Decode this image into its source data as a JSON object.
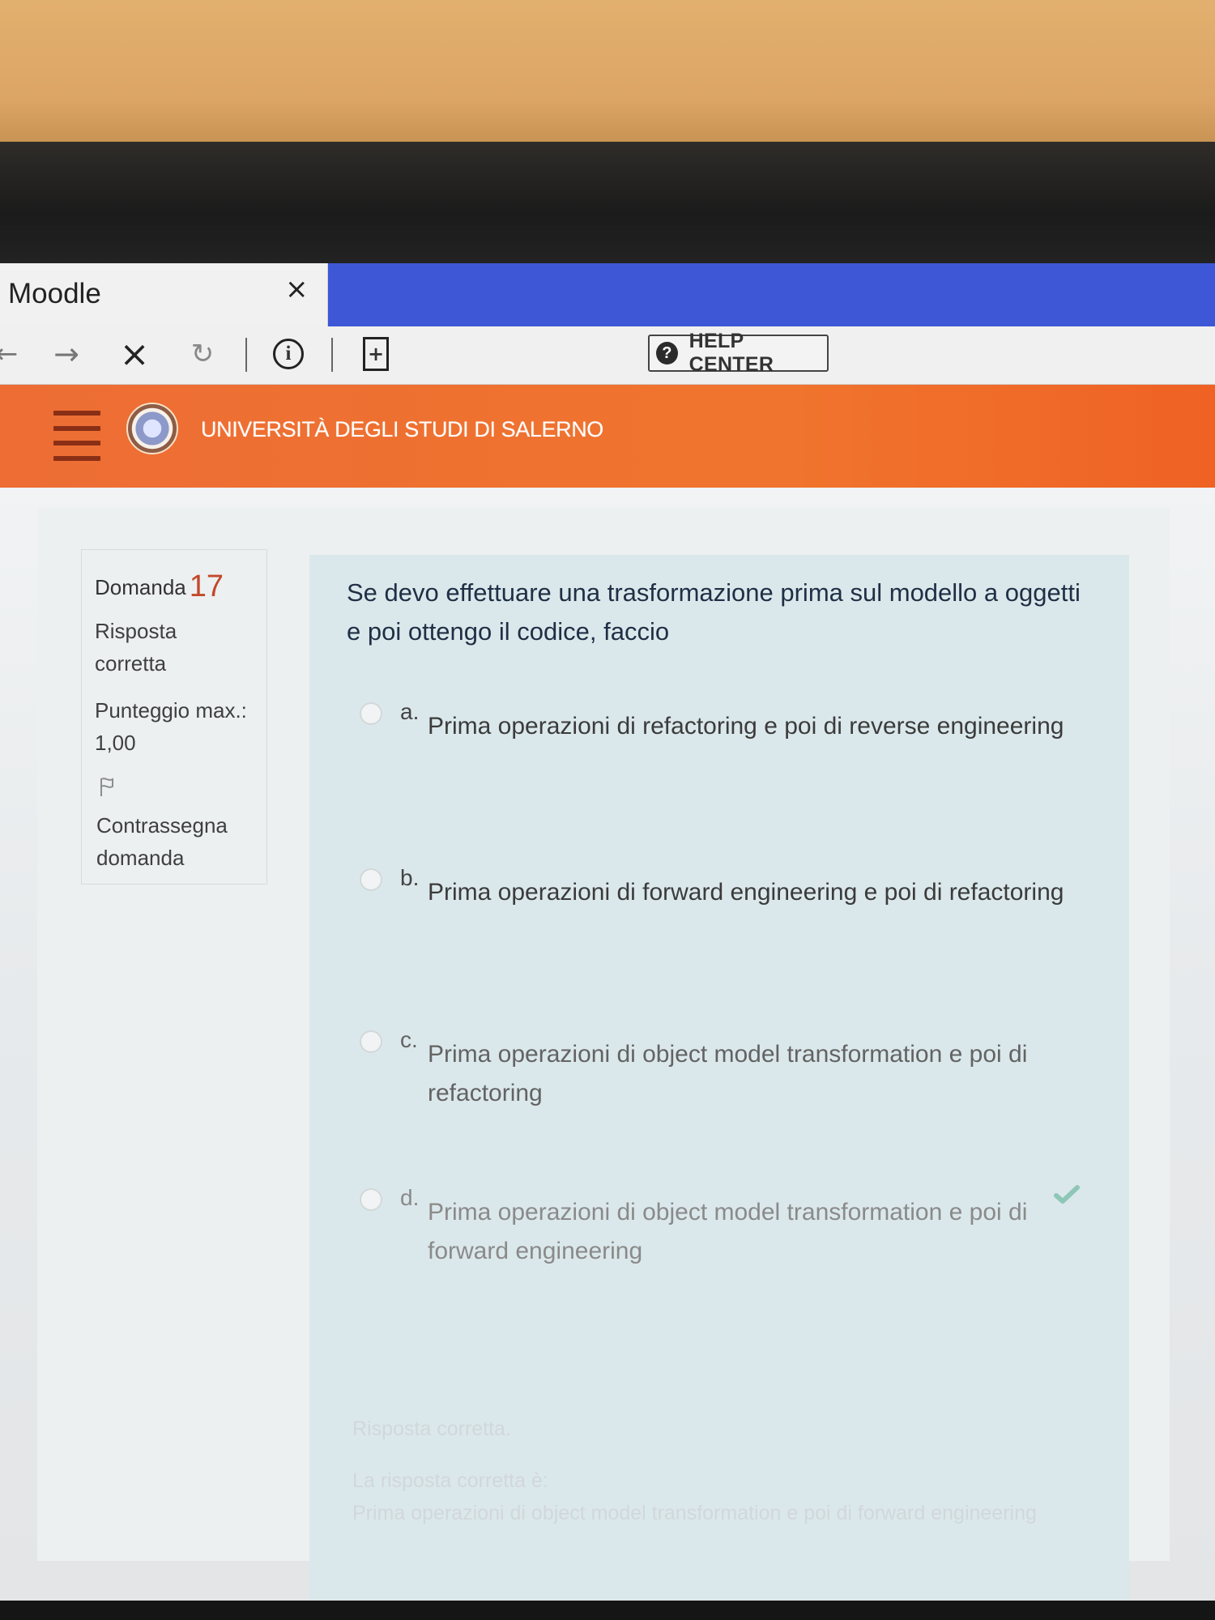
{
  "browser": {
    "tab_title": "Moodle",
    "help_center_label": "HELP CENTER"
  },
  "header": {
    "university_name": "UNIVERSITÀ DEGLI STUDI DI SALERNO"
  },
  "question_info": {
    "label": "Domanda",
    "number": "17",
    "status": "Risposta corretta",
    "score": "Punteggio max.: 1,00",
    "flag_text": "Contrassegna domanda"
  },
  "question": {
    "text": "Se devo effettuare una trasformazione prima sul modello a oggetti e poi ottengo il codice, faccio"
  },
  "answers": [
    {
      "letter": "a.",
      "text": "Prima operazioni di refactoring e poi di reverse engineering"
    },
    {
      "letter": "b.",
      "text": "Prima operazioni di forward engineering e poi di refactoring"
    },
    {
      "letter": "c.",
      "text": "Prima operazioni di object model transformation e poi di refactoring"
    },
    {
      "letter": "d.",
      "text": "Prima operazioni di object model transformation e poi di forward engineering"
    }
  ],
  "feedback": {
    "title": "Risposta corretta.",
    "line1": "La risposta corretta è:",
    "line2": "Prima operazioni di object model transformation e poi di forward engineering"
  },
  "colors": {
    "header_orange": "#ef6a2c",
    "tab_blue": "#3d57d6",
    "correct_check": "#8ec7b7"
  }
}
